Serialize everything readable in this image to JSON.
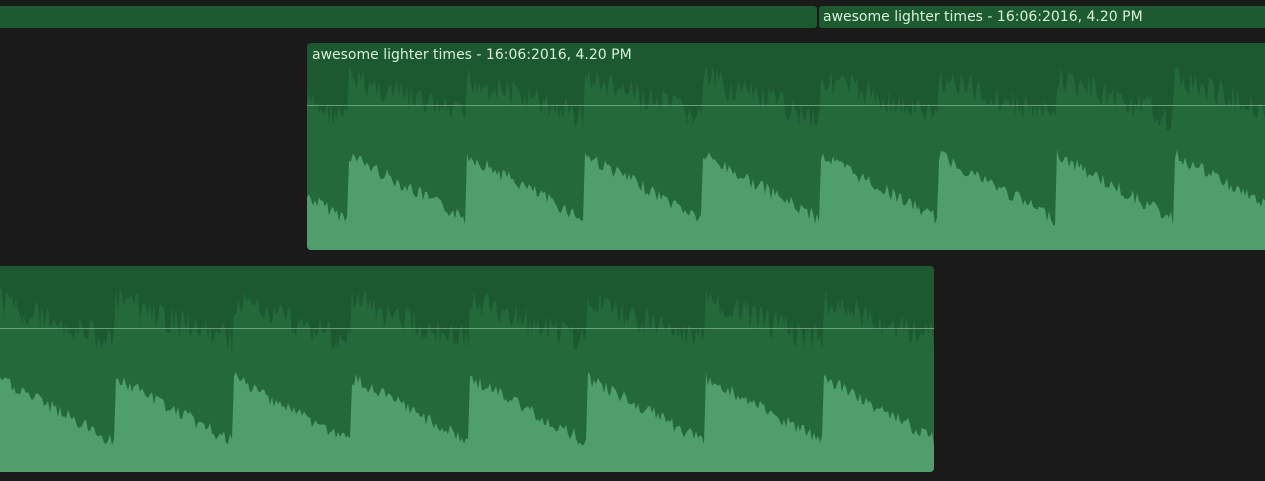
{
  "timeline": {
    "top_clips": [
      {
        "label": ""
      },
      {
        "label": "awesome lighter times - 16:06:2016, 4.20 PM"
      }
    ],
    "main_clip": {
      "title": "awesome lighter times - 16:06:2016, 4.20 PM",
      "volume_level": 0
    },
    "lower_clip": {
      "title": "",
      "volume_level": 0
    }
  },
  "colors": {
    "background": "#1a1a1a",
    "clip_body": "#1c5830",
    "wave_dark": "#24693a",
    "wave_light": "#4f9e6c",
    "level_line": "#7fb88d",
    "title_text": "#d8f0dc"
  }
}
